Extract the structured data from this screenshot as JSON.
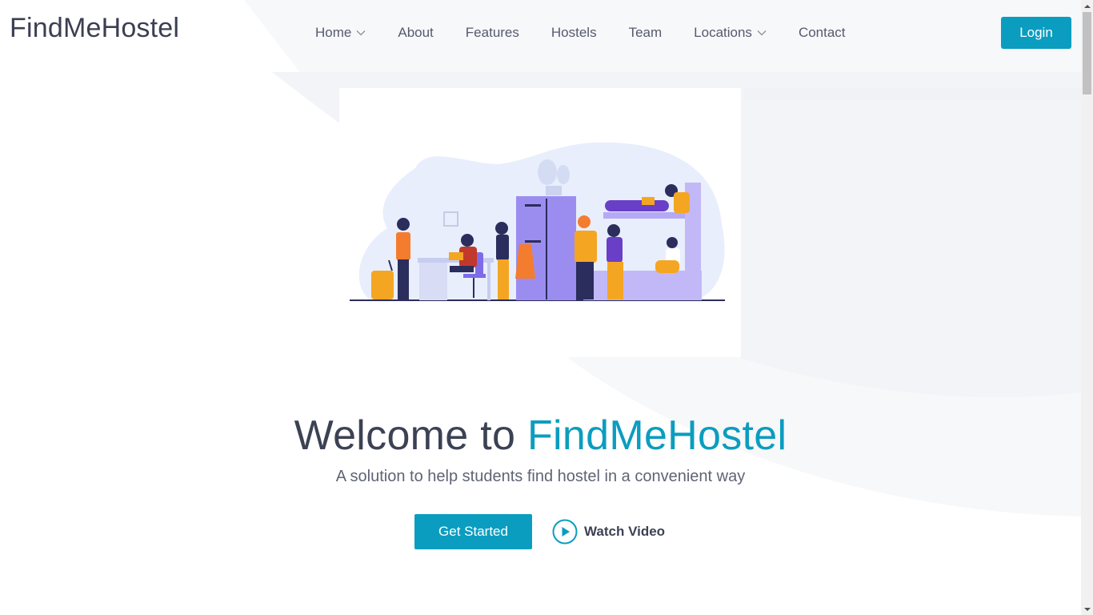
{
  "header": {
    "logo": "FindMeHostel",
    "nav": [
      {
        "label": "Home",
        "dropdown": true
      },
      {
        "label": "About",
        "dropdown": false
      },
      {
        "label": "Features",
        "dropdown": false
      },
      {
        "label": "Hostels",
        "dropdown": false
      },
      {
        "label": "Team",
        "dropdown": false
      },
      {
        "label": "Locations",
        "dropdown": true
      },
      {
        "label": "Contact",
        "dropdown": false
      }
    ],
    "login_label": "Login"
  },
  "hero": {
    "title_prefix": "Welcome to ",
    "title_brand": "FindMeHostel",
    "subtitle": "A solution to help students find hostel in a convenient way",
    "get_started_label": "Get Started",
    "watch_video_label": "Watch Video"
  },
  "colors": {
    "accent": "#0b9dbf",
    "text_dark": "#3c4254",
    "nav_text": "#555a6e"
  },
  "icons": [
    "chevron-down-icon",
    "play-circle-icon",
    "scroll-up-arrow-icon",
    "scroll-down-arrow-icon"
  ]
}
